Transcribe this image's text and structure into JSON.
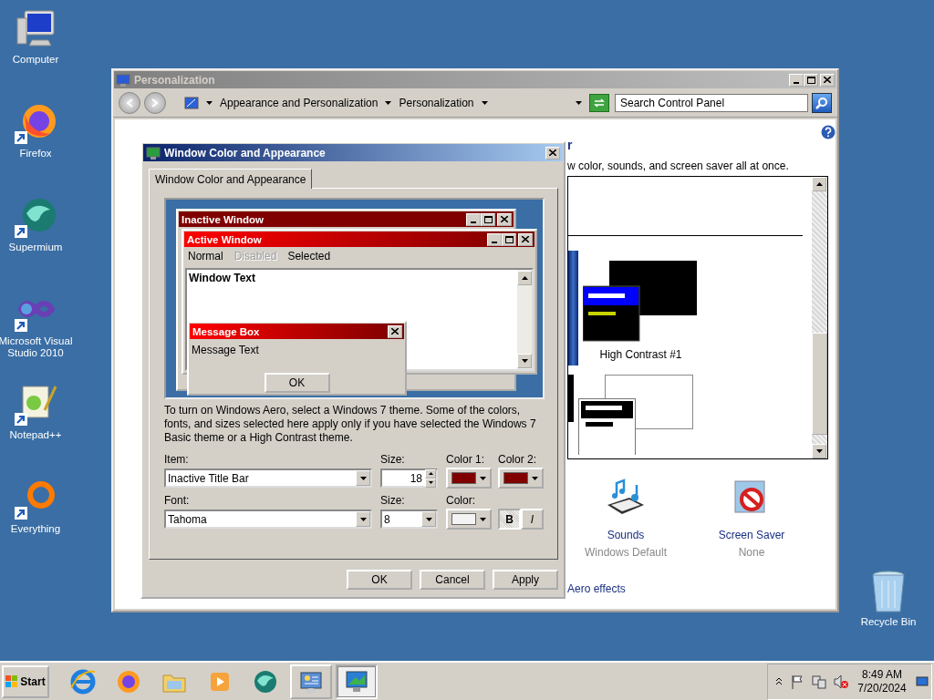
{
  "desktop_icons": [
    {
      "label": "Computer"
    },
    {
      "label": "Firefox"
    },
    {
      "label": "Supermium"
    },
    {
      "label": "Microsoft Visual Studio 2010"
    },
    {
      "label": "Notepad++"
    },
    {
      "label": "Everything"
    }
  ],
  "recycle_bin": {
    "label": "Recycle Bin"
  },
  "personalization": {
    "title": "Personalization",
    "breadcrumb": [
      "Appearance and Personalization",
      "Personalization"
    ],
    "search": {
      "placeholder": "Search Control Panel"
    },
    "heading": "r",
    "description": "w color, sounds, and screen saver all at once.",
    "themes": [
      {
        "label": "High Contrast #1"
      }
    ],
    "settings": [
      {
        "label": "Sounds",
        "value": "Windows Default"
      },
      {
        "label": "Screen Saver",
        "value": "None"
      }
    ],
    "link": "Aero effects"
  },
  "dialog": {
    "title": "Window Color and Appearance",
    "tabs": [
      {
        "label": "Window Color and Appearance",
        "selected": true
      }
    ],
    "preview": {
      "inactive_title": "Inactive Window",
      "active_title": "Active Window",
      "menu": [
        {
          "label": "Normal",
          "disabled": false
        },
        {
          "label": "Disabled",
          "disabled": true
        },
        {
          "label": "Selected",
          "disabled": false
        }
      ],
      "window_text": "Window Text",
      "message_title": "Message Box",
      "message_text": "Message Text",
      "message_button": "OK"
    },
    "note": "To turn on Windows Aero, select a Windows 7 theme.  Some of the colors, fonts, and sizes selected here apply only if you have selected the Windows 7 Basic theme or a High Contrast theme.",
    "item": {
      "label": "Item:",
      "value": "Inactive Title Bar"
    },
    "size": {
      "label": "Size:",
      "value": "18"
    },
    "color1": {
      "label": "Color 1:",
      "color": "#800000"
    },
    "color2": {
      "label": "Color 2:",
      "color": "#800000"
    },
    "font": {
      "label": "Font:",
      "value": "Tahoma"
    },
    "font_size": {
      "label": "Size:",
      "value": "8"
    },
    "font_color": {
      "label": "Color:",
      "color": "#f4f4f4"
    },
    "styles": [
      {
        "label": "B",
        "on": true
      },
      {
        "label": "I",
        "on": false
      }
    ],
    "buttons": [
      "OK",
      "Cancel",
      "Apply"
    ]
  },
  "taskbar": {
    "start": "Start",
    "apps": [
      {
        "open": false,
        "selected": false
      },
      {
        "open": false,
        "selected": false
      },
      {
        "open": false,
        "selected": false
      },
      {
        "open": false,
        "selected": false
      },
      {
        "open": false,
        "selected": false
      },
      {
        "open": true,
        "selected": false
      },
      {
        "open": true,
        "selected": true
      }
    ],
    "clock": {
      "time": "8:49 AM",
      "date": "7/20/2024"
    }
  }
}
